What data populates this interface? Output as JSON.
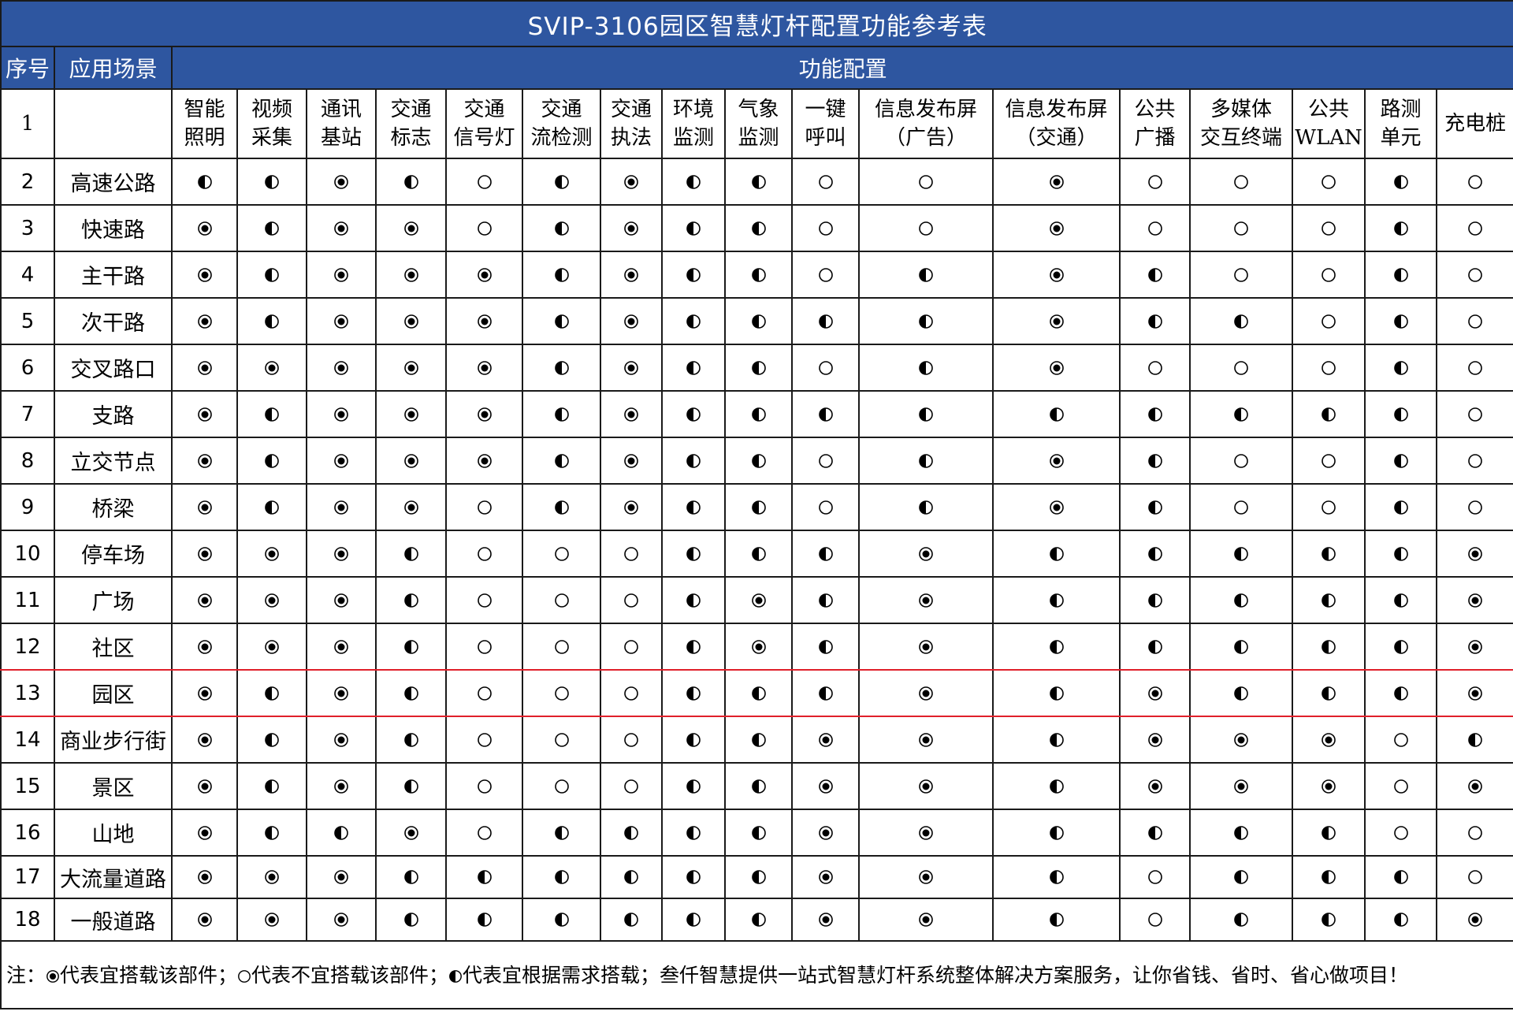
{
  "title": "SVIP-3106园区智慧灯杆配置功能参考表",
  "header": {
    "seq": "序号",
    "scenario": "应用场景",
    "features": "功能配置"
  },
  "feature_row": {
    "index": "1",
    "features": [
      {
        "l1": "智能",
        "l2": "照明"
      },
      {
        "l1": "视频",
        "l2": "采集"
      },
      {
        "l1": "通讯",
        "l2": "基站"
      },
      {
        "l1": "交通",
        "l2": "标志"
      },
      {
        "l1": "交通",
        "l2": "信号灯"
      },
      {
        "l1": "交通",
        "l2": "流检测"
      },
      {
        "l1": "交通",
        "l2": "执法"
      },
      {
        "l1": "环境",
        "l2": "监测"
      },
      {
        "l1": "气象",
        "l2": "监测"
      },
      {
        "l1": "一键",
        "l2": "呼叫"
      },
      {
        "l1": "信息发布屏",
        "l2": "（广告）"
      },
      {
        "l1": "信息发布屏",
        "l2": "（交通）"
      },
      {
        "l1": "公共",
        "l2": "广播"
      },
      {
        "l1": "多媒体",
        "l2": "交互终端"
      },
      {
        "l1": "公共",
        "l2": "WLAN"
      },
      {
        "l1": "路测",
        "l2": "单元"
      },
      {
        "l1": "充电桩",
        "l2": ""
      }
    ]
  },
  "legend_values": {
    "full": "◉",
    "none": "○",
    "half": "◐"
  },
  "rows": [
    {
      "n": "2",
      "name": "高速公路",
      "v": "HHFHNHFHHNNFNNNHN"
    },
    {
      "n": "3",
      "name": "快速路",
      "v": "FHFFNHFHHNNFNNNHN"
    },
    {
      "n": "4",
      "name": "主干路",
      "v": "FHFFFHFHHNHFHNNHN"
    },
    {
      "n": "5",
      "name": "次干路",
      "v": "FHFFFHFHHHHFHHNHN"
    },
    {
      "n": "6",
      "name": "交叉路口",
      "v": "FFFFFHFHHNHFNNNHN"
    },
    {
      "n": "7",
      "name": "支路",
      "v": "FHFFFHFHHHHHHHHHN"
    },
    {
      "n": "8",
      "name": "立交节点",
      "v": "FHFFFHFHHNHFHNNHN"
    },
    {
      "n": "9",
      "name": "桥梁",
      "v": "FHFFNHFHHNHFHNNHN"
    },
    {
      "n": "10",
      "name": "停车场",
      "v": "FFFHNNNHHHFHHHHHF"
    },
    {
      "n": "11",
      "name": "广场",
      "v": "FFFHNNNHFHFHHHHHF"
    },
    {
      "n": "12",
      "name": "社区",
      "v": "FFFHNNNHFHFHHHHHF"
    },
    {
      "n": "13",
      "name": "园区",
      "v": "FHFHNNNHHHFHFHHHF"
    },
    {
      "n": "14",
      "name": "商业步行街",
      "v": "FHFHNNNHHFFHFFFNH"
    },
    {
      "n": "15",
      "name": "景区",
      "v": "FHFHNNNHHFFHFFFNF"
    },
    {
      "n": "16",
      "name": "山地",
      "v": "FHHFNHHHHFFHHHHNN"
    },
    {
      "n": "17",
      "name": "大流量道路",
      "v": "FFFHHHHHHFFHNHHHN"
    },
    {
      "n": "18",
      "name": "一般道路",
      "v": "FFFHHHHHHFFHNHHHF"
    }
  ],
  "note": {
    "prefix": "注：",
    "full_text": "代表宜搭载该部件；",
    "none_text": "代表不宜搭载该部件；",
    "half_text": "代表宜根据需求搭载；叁仟智慧提供一站式智慧灯杆系统整体解决方案服务，让你省钱、省时、省心做项目！"
  },
  "colors": {
    "header_bg": "#2e56a0",
    "header_text": "#ffffff",
    "highlight_line": "#e0202a"
  }
}
